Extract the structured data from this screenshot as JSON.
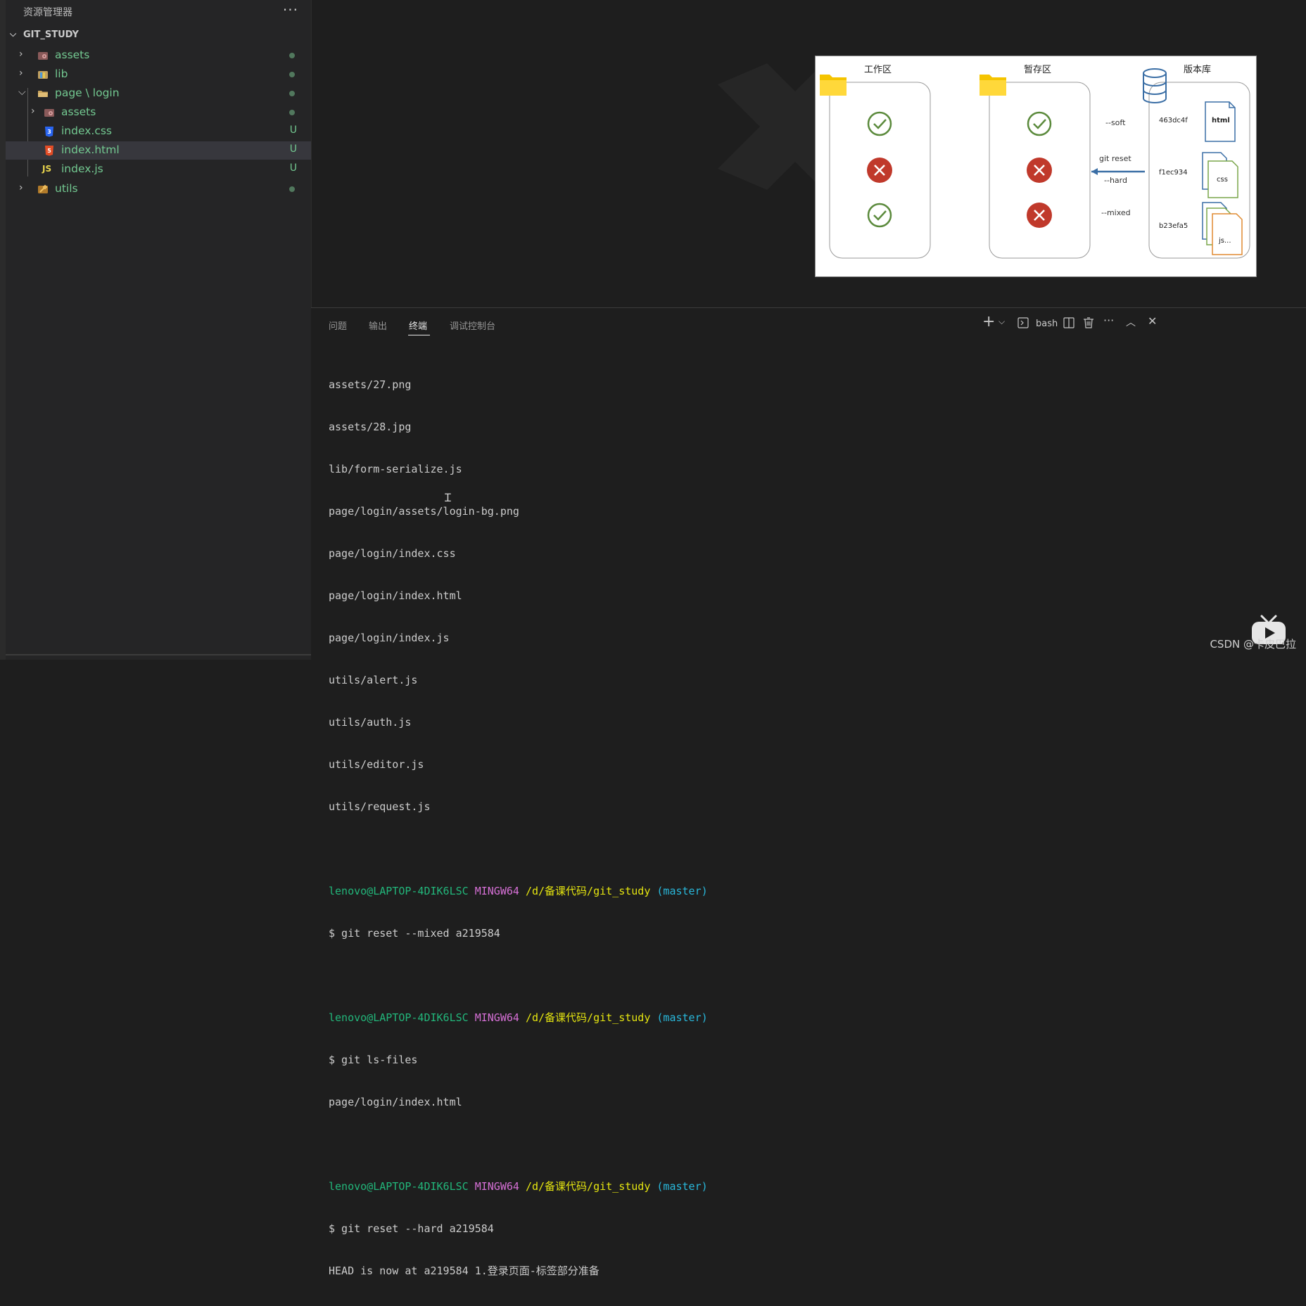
{
  "sidebar": {
    "title": "资源管理器",
    "more": "···",
    "root": "GIT_STUDY",
    "items": [
      {
        "label": "assets",
        "status": "dot"
      },
      {
        "label": "lib",
        "status": "dot"
      },
      {
        "label": "page \\ login",
        "status": "dot"
      },
      {
        "label": "assets",
        "status": "dot"
      },
      {
        "label": "index.css",
        "status": "U"
      },
      {
        "label": "index.html",
        "status": "U"
      },
      {
        "label": "index.js",
        "status": "U"
      },
      {
        "label": "utils",
        "status": "dot"
      }
    ]
  },
  "diagram": {
    "col1": "工作区",
    "col2": "暂存区",
    "col3": "版本库",
    "soft": "--soft",
    "reset": "git reset",
    "hard": "--hard",
    "mixed": "--mixed",
    "commits": [
      "463dc4f",
      "f1ec934",
      "b23efa5"
    ],
    "files": [
      "html",
      "css",
      "js..."
    ]
  },
  "panel": {
    "tabs": [
      "问题",
      "输出",
      "终端",
      "调试控制台"
    ],
    "active_tab": "终端",
    "shell": "bash"
  },
  "terminal": {
    "files1": [
      "assets/27.png",
      "assets/28.jpg",
      "lib/form-serialize.js",
      "page/login/assets/login-bg.png",
      "page/login/index.css",
      "page/login/index.html",
      "page/login/index.js",
      "utils/alert.js",
      "utils/auth.js",
      "utils/editor.js",
      "utils/request.js"
    ],
    "prompt_user": "lenovo@LAPTOP-4DIK6LSC",
    "prompt_sys": "MINGW64",
    "prompt_path": "/d/备课代码/git_study",
    "prompt_branch": "(master)",
    "cmd1": "$ git reset --mixed a219584",
    "cmd2": "$ git ls-files",
    "out2": "page/login/index.html",
    "cmd3": "$ git reset --hard a219584",
    "out3": "HEAD is now at a219584 1.登录页面-标签部分准备"
  },
  "brand": "CSDN @卡皮巴拉",
  "colors": {
    "untracked": "#73c991",
    "check": "#5b8a3c",
    "cross": "#c0392b",
    "arrow": "#3a6ea5"
  }
}
